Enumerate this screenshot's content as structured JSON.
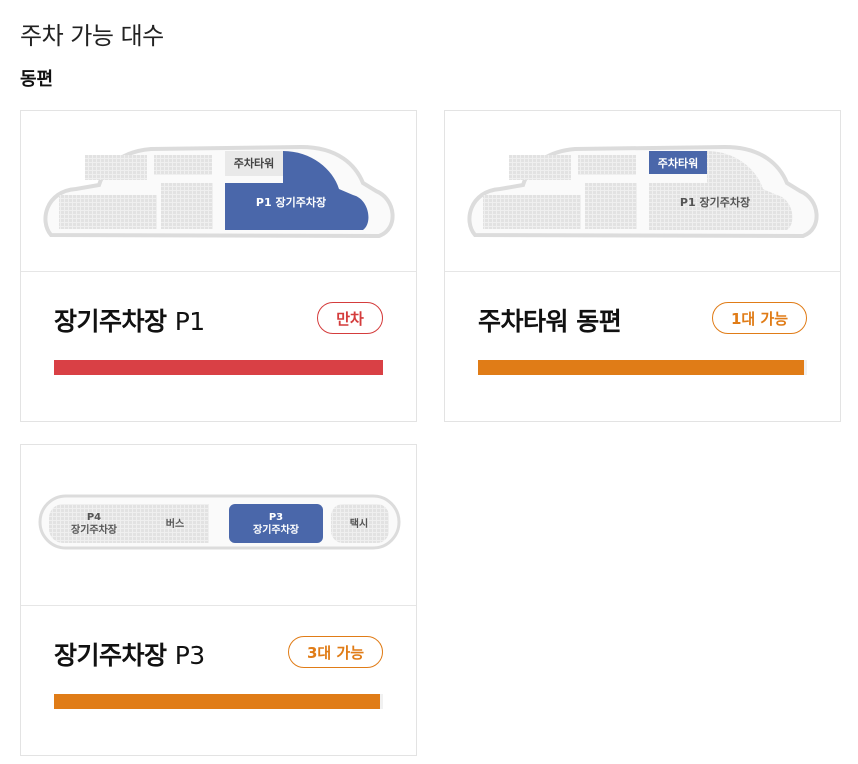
{
  "page": {
    "title": "주차 가능 대수",
    "section": "동편"
  },
  "lots": [
    {
      "name": "장기주차장",
      "code": "P1",
      "status": "만차",
      "status_type": "full",
      "fill_fraction": 1.0,
      "color": "#d94045",
      "map_labels": {
        "tower": "주차타워",
        "lot": "P1 장기주차장"
      }
    },
    {
      "name": "주차타워 동편",
      "code": "",
      "status": "1대 가능",
      "status_type": "available",
      "fill_fraction": 0.99,
      "color": "#e07c17",
      "map_labels": {
        "tower": "주차타워",
        "lot": "P1 장기주차장"
      }
    },
    {
      "name": "장기주차장",
      "code": "P3",
      "status": "3대 가능",
      "status_type": "available",
      "fill_fraction": 0.99,
      "color": "#e07c17",
      "map_labels": {
        "p4_a": "P4",
        "p4_b": "장기주차장",
        "bus": "버스",
        "p3_a": "P3",
        "p3_b": "장기주차장",
        "taxi": "택시"
      }
    }
  ],
  "colors": {
    "highlight": "#4a67aa",
    "full": "#d43c3c",
    "available": "#e07c17",
    "map_block": "#e6e6e6",
    "map_outline": "#dedede"
  }
}
